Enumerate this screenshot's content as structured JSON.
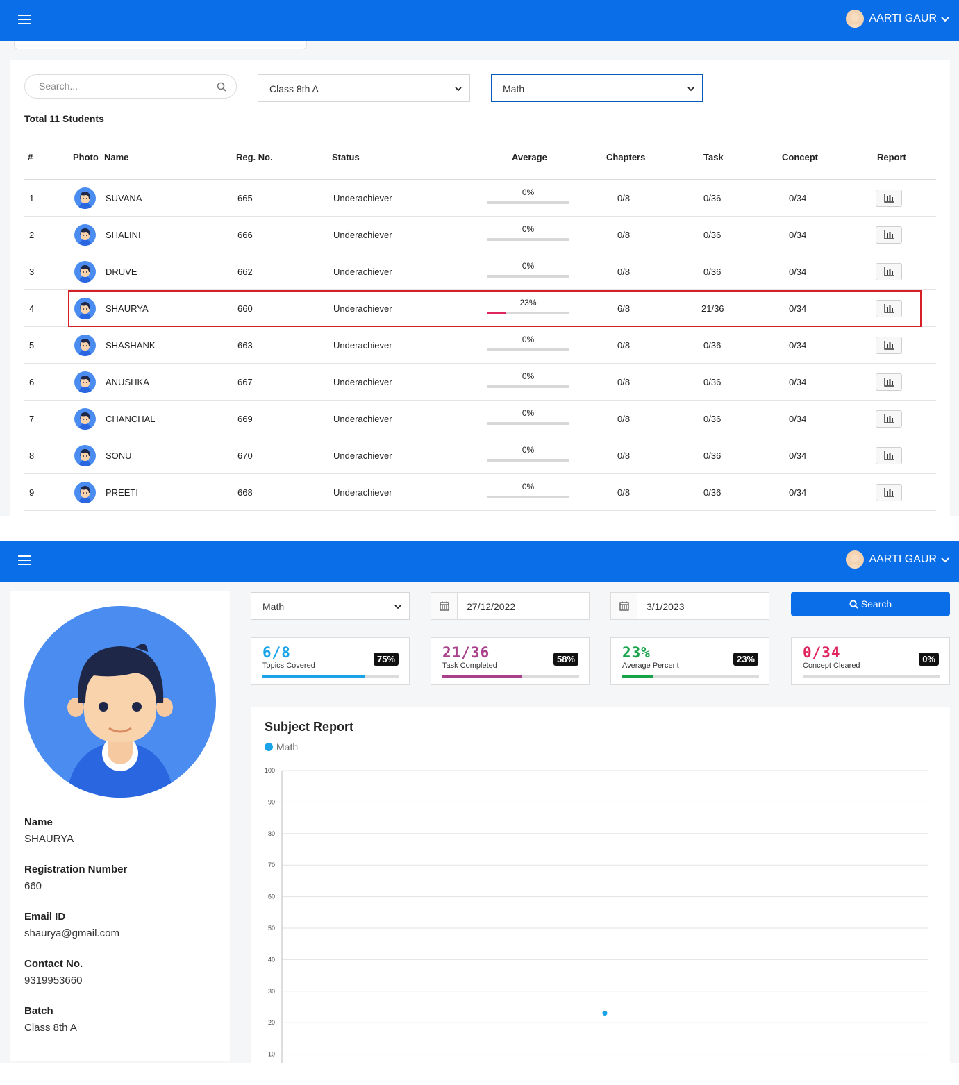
{
  "header": {
    "user_name": "AARTI GAUR"
  },
  "table_view": {
    "search_placeholder": "Search...",
    "class_select": "Class 8th A",
    "subject_select": "Math",
    "total_label": "Total 11 Students",
    "columns": [
      "#",
      "Photo",
      "Name",
      "Reg. No.",
      "Status",
      "Average",
      "Chapters",
      "Task",
      "Concept",
      "Report"
    ],
    "rows": [
      {
        "num": "1",
        "name": "SUVANA",
        "reg": "665",
        "status": "Underachiever",
        "avg": "0%",
        "avg_value": 0,
        "chapters": "0/8",
        "task": "0/36",
        "concept": "0/34"
      },
      {
        "num": "2",
        "name": "SHALINI",
        "reg": "666",
        "status": "Underachiever",
        "avg": "0%",
        "avg_value": 0,
        "chapters": "0/8",
        "task": "0/36",
        "concept": "0/34"
      },
      {
        "num": "3",
        "name": "DRUVE",
        "reg": "662",
        "status": "Underachiever",
        "avg": "0%",
        "avg_value": 0,
        "chapters": "0/8",
        "task": "0/36",
        "concept": "0/34"
      },
      {
        "num": "4",
        "name": "SHAURYA",
        "reg": "660",
        "status": "Underachiever",
        "avg": "23%",
        "avg_value": 23,
        "chapters": "6/8",
        "task": "21/36",
        "concept": "0/34"
      },
      {
        "num": "5",
        "name": "SHASHANK",
        "reg": "663",
        "status": "Underachiever",
        "avg": "0%",
        "avg_value": 0,
        "chapters": "0/8",
        "task": "0/36",
        "concept": "0/34"
      },
      {
        "num": "6",
        "name": "ANUSHKA",
        "reg": "667",
        "status": "Underachiever",
        "avg": "0%",
        "avg_value": 0,
        "chapters": "0/8",
        "task": "0/36",
        "concept": "0/34"
      },
      {
        "num": "7",
        "name": "CHANCHAL",
        "reg": "669",
        "status": "Underachiever",
        "avg": "0%",
        "avg_value": 0,
        "chapters": "0/8",
        "task": "0/36",
        "concept": "0/34"
      },
      {
        "num": "8",
        "name": "SONU",
        "reg": "670",
        "status": "Underachiever",
        "avg": "0%",
        "avg_value": 0,
        "chapters": "0/8",
        "task": "0/36",
        "concept": "0/34"
      },
      {
        "num": "9",
        "name": "PREETI",
        "reg": "668",
        "status": "Underachiever",
        "avg": "0%",
        "avg_value": 0,
        "chapters": "0/8",
        "task": "0/36",
        "concept": "0/34"
      }
    ]
  },
  "report_view": {
    "profile": {
      "name_label": "Name",
      "name": "SHAURYA",
      "reg_label": "Registration Number",
      "reg": "660",
      "email_label": "Email ID",
      "email": "shaurya@gmail.com",
      "contact_label": "Contact No.",
      "contact": "9319953660",
      "batch_label": "Batch",
      "batch": "Class 8th A"
    },
    "subject_select": "Math",
    "date_from": "27/12/2022",
    "date_to": "3/1/2023",
    "search_label": "Search",
    "stats": [
      {
        "value": "6/8",
        "label": "Topics Covered",
        "badge": "75%",
        "pct": 75,
        "color": "#1aa3e8"
      },
      {
        "value": "21/36",
        "label": "Task Completed",
        "badge": "58%",
        "pct": 58,
        "color": "#a9418a"
      },
      {
        "value": "23%",
        "label": "Average Percent",
        "badge": "23%",
        "pct": 23,
        "color": "#18a34a"
      },
      {
        "value": "0/34",
        "label": "Concept Cleared",
        "badge": "0%",
        "pct": 0,
        "color": "#e0245e"
      }
    ]
  },
  "chart_data": {
    "type": "scatter",
    "title": "Subject Report",
    "legend": "top-left",
    "grid": true,
    "series": [
      {
        "name": "Math",
        "color": "#1aa3e8",
        "points": [
          {
            "y": 23
          }
        ]
      }
    ],
    "yticks": [
      "100",
      "90",
      "80",
      "70",
      "60",
      "50",
      "40",
      "30",
      "20",
      "10"
    ],
    "ylim": [
      0,
      100
    ]
  }
}
